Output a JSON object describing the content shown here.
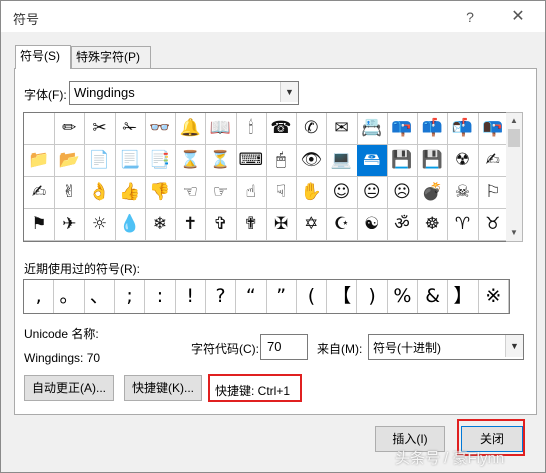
{
  "window": {
    "title": "符号",
    "help_glyph": "?",
    "close_glyph": "✕"
  },
  "tabs": [
    {
      "label": "符号(S)",
      "active": true
    },
    {
      "label": "特殊字符(P)",
      "active": false
    }
  ],
  "font": {
    "label": "字体(F):",
    "value": "Wingdings"
  },
  "grid": {
    "selected_index": 27,
    "cells": [
      " ",
      "✏",
      "✂",
      "✁",
      "👓",
      "🔔",
      "📖",
      "🕯",
      "☎",
      "✆",
      "✉",
      "📇",
      "📪",
      "📫",
      "📬",
      "📭",
      "📁",
      "📂",
      "📄",
      "📃",
      "📑",
      "⌛",
      "⏳",
      "⌨",
      "🖱",
      "👁",
      "💻",
      "🖴",
      "💾",
      "💾",
      "☢",
      "✍",
      "✍",
      "✌",
      "👌",
      "👍",
      "👎",
      "☜",
      "☞",
      "☝",
      "☟",
      "✋",
      "☺",
      "😐",
      "☹",
      "💣",
      "☠",
      "⚐",
      "⚑",
      "✈",
      "☼",
      "💧",
      "❄",
      "✝",
      "✞",
      "✟",
      "✠",
      "✡",
      "☪",
      "☯",
      "ॐ",
      "☸",
      "♈",
      "♉"
    ]
  },
  "recent": {
    "label": "近期使用过的符号(R):",
    "items": [
      ",",
      "。",
      "、",
      ";",
      ":",
      "!",
      "?",
      "“",
      "”",
      "(",
      "【",
      ")",
      "%",
      "&",
      "】",
      "※"
    ]
  },
  "info": {
    "unicode_name_label": "Unicode 名称:",
    "char_name": "Wingdings: 70",
    "code_label": "字符代码(C):",
    "code_value": "70",
    "from_label": "来自(M):",
    "from_value": "符号(十进制)"
  },
  "buttons": {
    "autocorrect": "自动更正(A)...",
    "shortcut_key": "快捷键(K)...",
    "shortcut_text": "快捷键: Ctrl+1",
    "insert": "插入(I)",
    "close": "关闭"
  },
  "watermark": "头条号 / 豪Flynn",
  "colors": {
    "selection": "#0078d7",
    "highlight_frame": "#e02020"
  }
}
